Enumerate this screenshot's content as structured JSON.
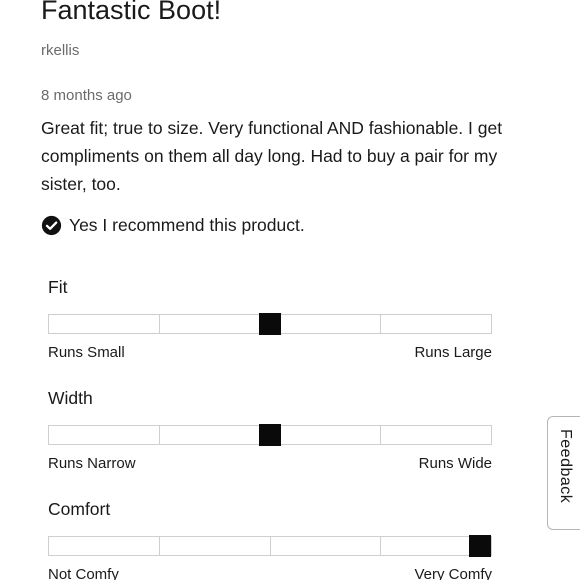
{
  "review": {
    "title": "Fantastic Boot!",
    "author": "rkellis",
    "date": "8 months ago",
    "body": "Great fit; true to size. Very functional AND fashionable. I get compliments on them all day long. Had to buy a pair for my sister, too.",
    "recommend_text": "Yes I recommend this product."
  },
  "ratings": [
    {
      "label": "Fit",
      "segments": 4,
      "position": 0.5,
      "low_label": "Runs Small",
      "high_label": "Runs Large"
    },
    {
      "label": "Width",
      "segments": 4,
      "position": 0.5,
      "low_label": "Runs Narrow",
      "high_label": "Runs Wide"
    },
    {
      "label": "Comfort",
      "segments": 4,
      "position": 1.0,
      "low_label": "Not Comfy",
      "high_label": "Very Comfy"
    }
  ],
  "feedback": {
    "label": "Feedback"
  },
  "icons": {
    "recommend": "check-circle-icon"
  },
  "colors": {
    "text": "#1a1a1a",
    "muted": "#6b6b6b",
    "marker": "#0a0a0a",
    "segment_border": "#cfcfcf"
  }
}
